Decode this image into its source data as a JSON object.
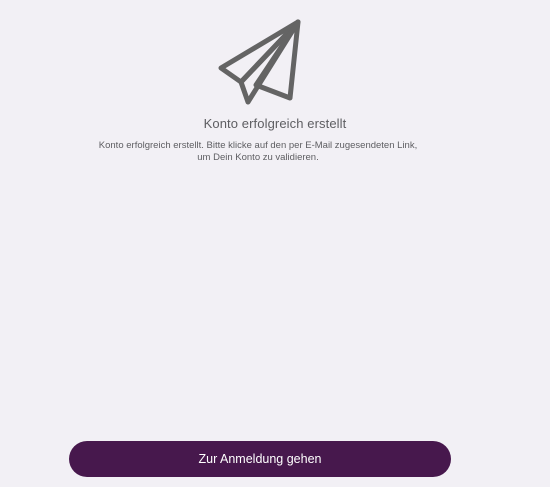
{
  "screen": {
    "icon": "paper-plane-icon",
    "title": "Konto erfolgreich erstellt",
    "message": "Konto erfolgreich erstellt. Bitte klicke auf den per E-Mail zugesendeten Link, um Dein Konto zu validieren.",
    "button_label": "Zur Anmeldung gehen"
  },
  "colors": {
    "background": "#f2f0f5",
    "icon": "#646464",
    "text": "#5e5e62",
    "button": "#47184d",
    "button_text": "#ffffff"
  }
}
